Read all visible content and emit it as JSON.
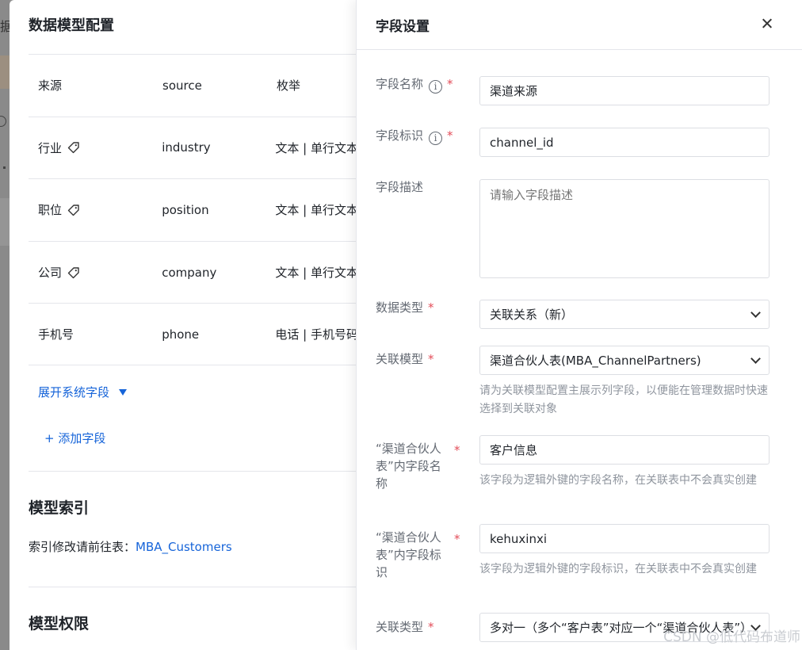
{
  "left_panel": {
    "title": "数据模型配置",
    "rows": [
      {
        "name": "来源",
        "id": "source",
        "type": "枚举",
        "tag": false
      },
      {
        "name": "行业",
        "id": "industry",
        "type": "文本 | 单行文本",
        "tag": true
      },
      {
        "name": "职位",
        "id": "position",
        "type": "文本 | 单行文本",
        "tag": true
      },
      {
        "name": "公司",
        "id": "company",
        "type": "文本 | 单行文本",
        "tag": true
      },
      {
        "name": "手机号",
        "id": "phone",
        "type": "电话 | 手机号码",
        "tag": false
      }
    ],
    "expand_label": "展开系统字段",
    "add_field_label": "+ 添加字段",
    "index_title": "模型索引",
    "index_note": "索引修改请前往表：",
    "index_link": "MBA_Customers",
    "permission_title": "模型权限"
  },
  "right_panel": {
    "title": "字段设置",
    "field_name_label": "字段名称",
    "field_name_value": "渠道来源",
    "field_id_label": "字段标识",
    "field_id_value": "channel_id",
    "field_desc_label": "字段描述",
    "field_desc_placeholder": "请输入字段描述",
    "data_type_label": "数据类型",
    "data_type_value": "关联关系（新）",
    "rel_model_label": "关联模型",
    "rel_model_value": "渠道合伙人表(MBA_ChannelPartners)",
    "rel_model_hint": "请为关联模型配置主展示列字段，以便能在管理数据时快速选择到关联对象",
    "fk_name_label": "“渠道合伙人表”内字段名称",
    "fk_name_value": "客户信息",
    "fk_name_hint": "该字段为逻辑外键的字段名称，在关联表中不会真实创建",
    "fk_id_label": "“渠道合伙人表”内字段标识",
    "fk_id_value": "kehuxinxi",
    "fk_id_hint": "该字段为逻辑外键的字段标识，在关联表中不会真实创建",
    "rel_type_label": "关联类型",
    "rel_type_value": "多对一（多个“客户表”对应一个“渠道合伙人表”）",
    "required_mark": "*",
    "info_glyph": "i"
  },
  "background": {
    "title_char": "据"
  },
  "watermark": "CSDN @低代码布道师"
}
